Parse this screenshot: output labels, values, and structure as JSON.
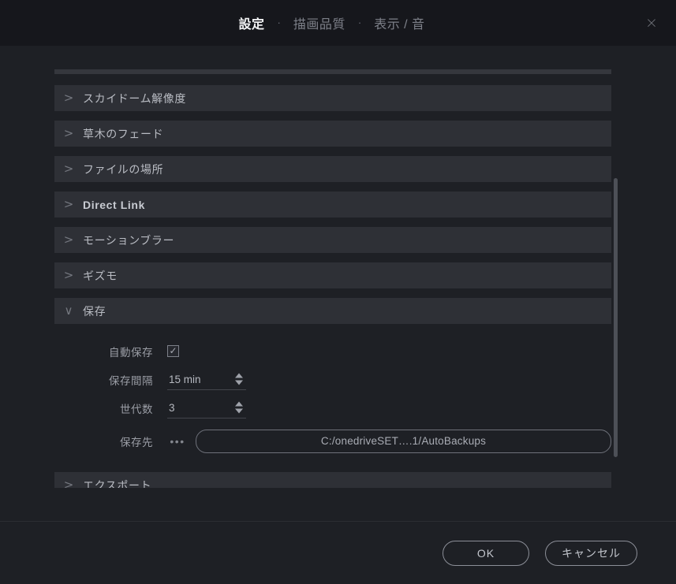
{
  "header": {
    "tabs": [
      {
        "label": "設定",
        "active": true
      },
      {
        "label": "描画品質",
        "active": false
      },
      {
        "label": "表示 / 音",
        "active": false
      }
    ],
    "separator": "·",
    "close_icon": "×"
  },
  "settings": {
    "chevron_collapsed": ">",
    "chevron_expanded": "∨",
    "sections": [
      {
        "label": "スカイドーム解像度",
        "expanded": false,
        "bold": false
      },
      {
        "label": "草木のフェード",
        "expanded": false,
        "bold": false
      },
      {
        "label": "ファイルの場所",
        "expanded": false,
        "bold": false
      },
      {
        "label": "Direct Link",
        "expanded": false,
        "bold": true
      },
      {
        "label": "モーションブラー",
        "expanded": false,
        "bold": false
      },
      {
        "label": "ギズモ",
        "expanded": false,
        "bold": false
      },
      {
        "label": "保存",
        "expanded": true,
        "bold": false
      },
      {
        "label": "エクスポート",
        "expanded": false,
        "bold": false
      }
    ]
  },
  "save_panel": {
    "autosave": {
      "label": "自動保存",
      "checked": true,
      "check_glyph": "✓"
    },
    "interval": {
      "label": "保存間隔",
      "value": "15 min"
    },
    "generations": {
      "label": "世代数",
      "value": "3"
    },
    "destination": {
      "label": "保存先",
      "browse_label": "•••",
      "path": "C:/onedriveSET….1/AutoBackups"
    }
  },
  "footer": {
    "ok_label": "OK",
    "cancel_label": "キャンセル"
  },
  "colors": {
    "dialog_bg": "#1e2025",
    "titlebar_bg": "#16171c",
    "row_bg": "#2e3036",
    "text_primary": "#c9cbd1",
    "text_muted": "#9a9da5",
    "border": "#6e717a"
  }
}
